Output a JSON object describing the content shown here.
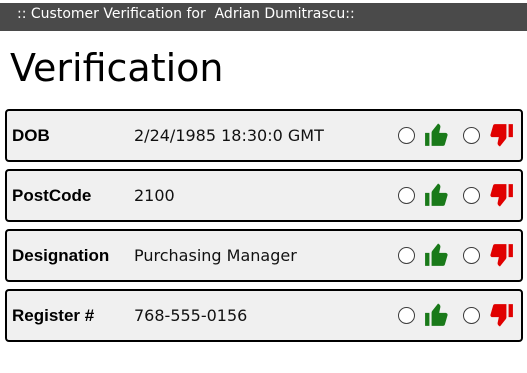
{
  "window": {
    "title": ":: Customer Verification for  Adrian Dumitrascu::"
  },
  "page": {
    "title": "Verification"
  },
  "colors": {
    "titlebar_bg": "#4a4a4a",
    "row_bg": "#f0f0f0",
    "approve_icon": "#1a7a1a",
    "reject_icon": "#e00000"
  },
  "icons": {
    "approve": "thumbs-up-icon",
    "reject": "thumbs-down-icon"
  },
  "fields": [
    {
      "label": "DOB",
      "value": "2/24/1985 18:30:0 GMT"
    },
    {
      "label": "PostCode",
      "value": "2100"
    },
    {
      "label": "Designation",
      "value": "Purchasing Manager"
    },
    {
      "label": "Register #",
      "value": "768-555-0156"
    }
  ]
}
